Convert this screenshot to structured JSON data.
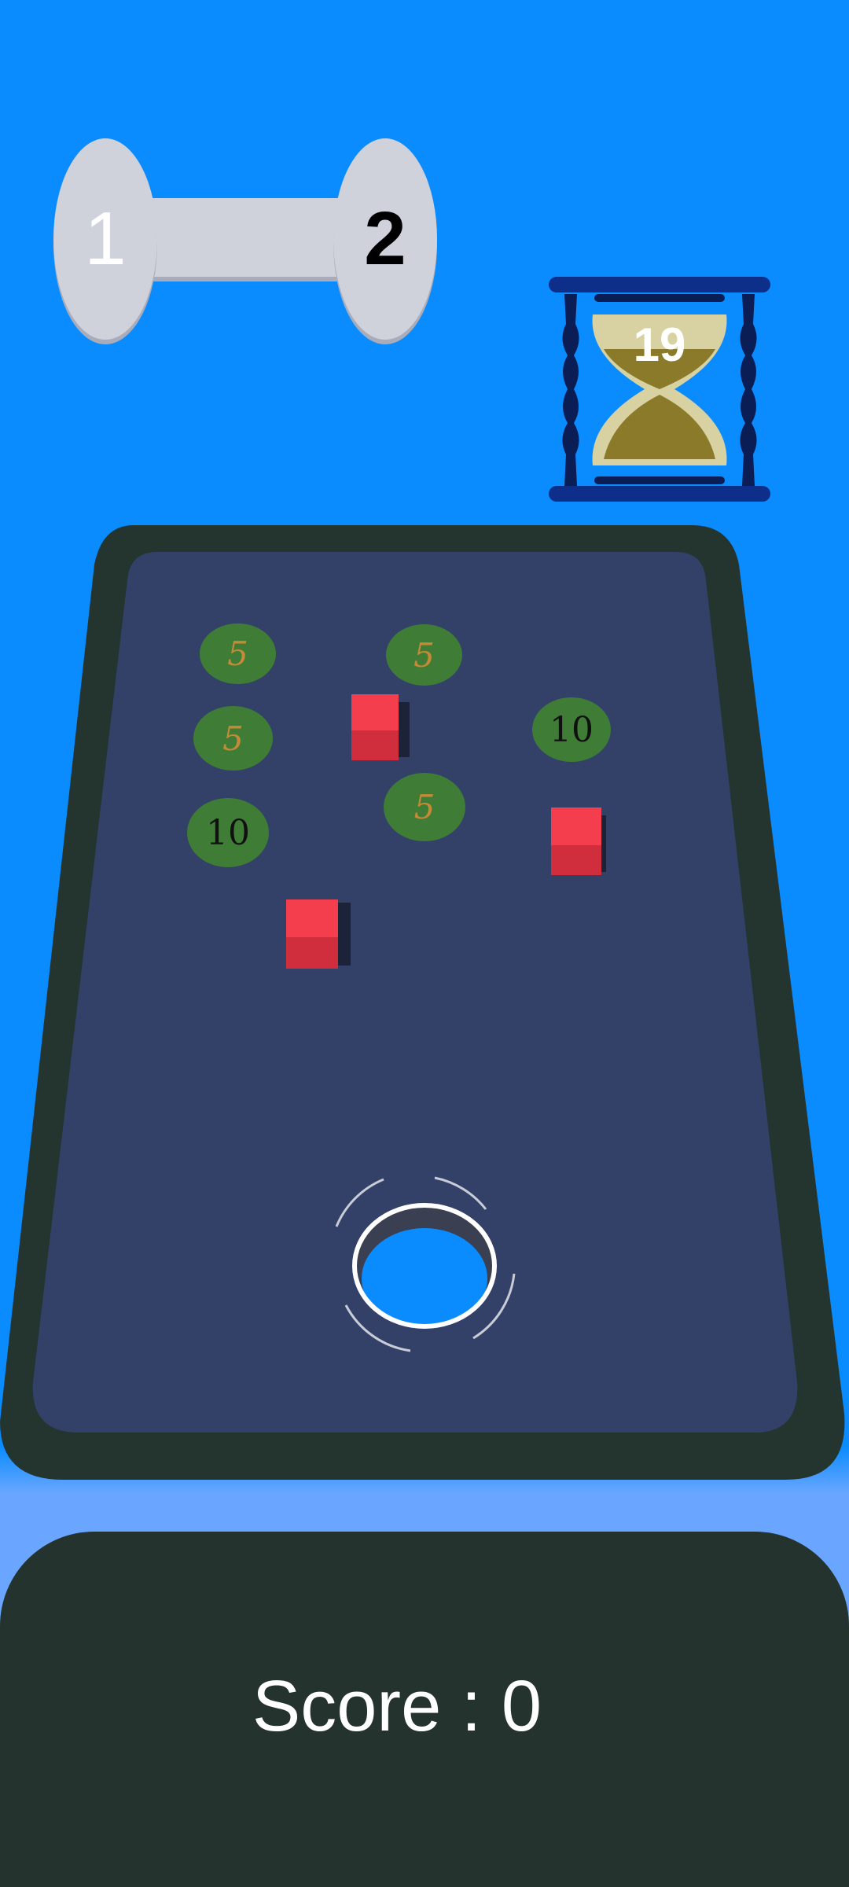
{
  "level": {
    "current": "1",
    "next": "2"
  },
  "timer": {
    "seconds": "19"
  },
  "board": {
    "coins": [
      {
        "value": "5"
      },
      {
        "value": "5"
      },
      {
        "value": "5"
      },
      {
        "value": "10"
      },
      {
        "value": "10"
      },
      {
        "value": "5"
      }
    ],
    "cube_count": 3
  },
  "score": {
    "text": "Score : 0"
  },
  "colors": {
    "sky": "#0a8cff",
    "board_surface": "#334169",
    "board_rim": "#243530",
    "coin": "#3f7d36",
    "cube": "#f43e4d",
    "score_panel": "#24332d"
  }
}
